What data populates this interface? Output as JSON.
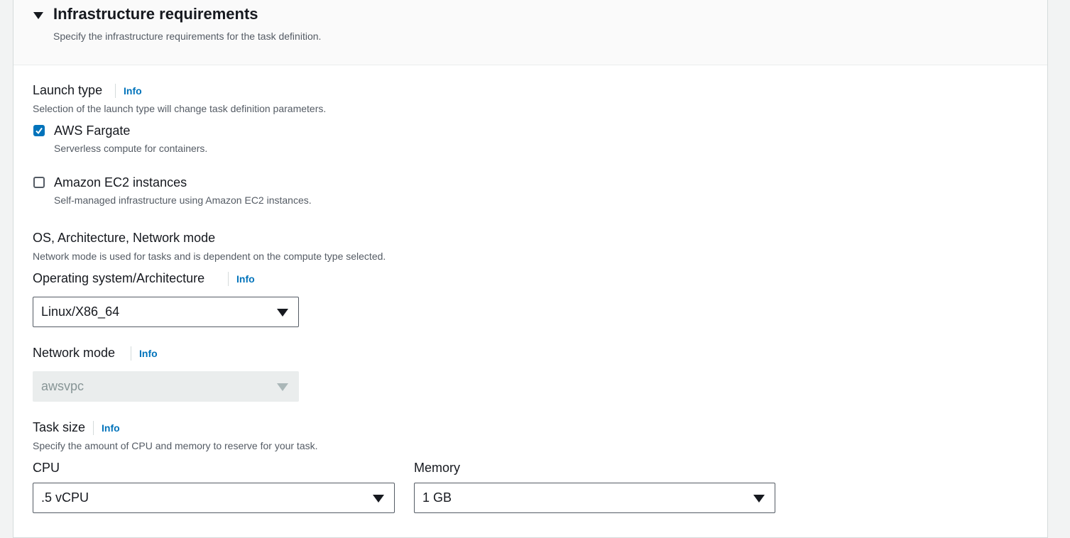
{
  "section": {
    "title": "Infrastructure requirements",
    "description": "Specify the infrastructure requirements for the task definition."
  },
  "launch_type": {
    "label": "Launch type",
    "info": "Info",
    "description": "Selection of the launch type will change task definition parameters.",
    "options": [
      {
        "label": "AWS Fargate",
        "description": "Serverless compute for containers.",
        "checked": true
      },
      {
        "label": "Amazon EC2 instances",
        "description": "Self-managed infrastructure using Amazon EC2 instances.",
        "checked": false
      }
    ]
  },
  "os_arch_network": {
    "label": "OS, Architecture, Network mode",
    "description": "Network mode is used for tasks and is dependent on the compute type selected."
  },
  "operating_system": {
    "label": "Operating system/Architecture",
    "info": "Info",
    "value": "Linux/X86_64"
  },
  "network_mode": {
    "label": "Network mode",
    "info": "Info",
    "value": "awsvpc",
    "disabled": true
  },
  "task_size": {
    "label": "Task size",
    "info": "Info",
    "description": "Specify the amount of CPU and memory to reserve for your task."
  },
  "cpu": {
    "label": "CPU",
    "value": ".5 vCPU"
  },
  "memory": {
    "label": "Memory",
    "value": "1 GB"
  },
  "colors": {
    "accent": "#0073bb",
    "text": "#16191f",
    "muted": "#545b64"
  }
}
